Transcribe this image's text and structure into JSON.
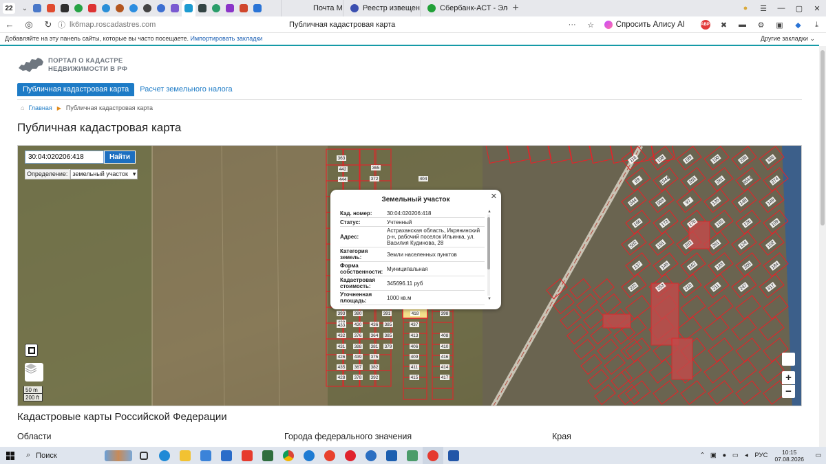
{
  "browser": {
    "tab_count": "22",
    "tabs": [
      {
        "label": "Почта Mail",
        "color": "#1f6fd6"
      },
      {
        "label": "Реестр извещений",
        "color": "#3b4fb0"
      },
      {
        "label": "Сбербанк-АСТ - Электрон",
        "color": "#21a038"
      }
    ],
    "url": "lk6map.roscadastres.com",
    "page_title": "Публичная кадастровая карта",
    "alice_label": "Спросить Алису AI",
    "bookmark_prompt": "Добавляйте на эту панель сайты, которые вы часто посещаете.",
    "bookmark_link": "Импортировать закладки",
    "other_bookmarks": "Другие закладки"
  },
  "site": {
    "logo_line1": "ПОРТАЛ О КАДАСТРЕ",
    "logo_line2": "НЕДВИЖИМОСТИ В РФ",
    "nav": [
      {
        "label": "Публичная кадастровая карта",
        "active": true
      },
      {
        "label": "Расчет земельного налога",
        "active": false
      }
    ],
    "breadcrumbs": {
      "home": "Главная",
      "current": "Публичная кадастровая карта"
    },
    "heading": "Публичная кадастровая карта",
    "section_title": "Кадастровые карты Российской Федерации",
    "columns": [
      "Области",
      "Города федерального значения",
      "Края"
    ]
  },
  "map": {
    "search_value": "30:04:020206:418",
    "search_button": "Найти",
    "definition_label": "Определение:",
    "definition_value": "земельный участок",
    "scale_metric": "50 m",
    "scale_imperial": "200 ft",
    "zoom_in": "+",
    "zoom_out": "−",
    "selected_parcel": "418",
    "parcel_numbers_left": [
      "363",
      "442",
      "444",
      "365",
      "372",
      "438",
      "380",
      "433",
      "432",
      "431",
      "426",
      "435",
      "428",
      "430",
      "376",
      "388",
      "439",
      "367",
      "378",
      "436",
      "364",
      "381",
      "375",
      "382",
      "392",
      "393",
      "391",
      "385",
      "385",
      "379"
    ],
    "parcel_numbers_mid": [
      "404",
      "437",
      "413",
      "406",
      "409",
      "411",
      "415",
      "398",
      "408",
      "410",
      "416",
      "414",
      "417"
    ],
    "parcel_numbers_right": [
      "116",
      "198",
      "199",
      "190",
      "298",
      "386",
      "89",
      "1944",
      "265",
      "281",
      "9644",
      "274",
      "344",
      "968",
      "97",
      "135",
      "148",
      "149",
      "166",
      "173",
      "170",
      "165",
      "126",
      "109",
      "502",
      "191",
      "203",
      "261",
      "124",
      "102",
      "137",
      "146",
      "162",
      "183",
      "205",
      "184",
      "222",
      "253",
      "210",
      "211",
      "247",
      "317"
    ]
  },
  "popup": {
    "title": "Земельный участок",
    "rows": [
      {
        "key": "Кад. номер:",
        "value": "30:04:020206:418"
      },
      {
        "key": "Статус:",
        "value": "Учтенный"
      },
      {
        "key": "Адрес:",
        "value": "Астраханская область, Икрянинский р-н, рабочий поселок Ильинка, ул. Василия Кудинова, 28"
      },
      {
        "key": "Категория земель:",
        "value": "Земли населенных пунктов"
      },
      {
        "key": "Форма собственности:",
        "value": "Муниципальная"
      },
      {
        "key": "Кадастровая стоимость:",
        "value": "345696.11 руб"
      },
      {
        "key": "Уточненная площадь:",
        "value": "1000 кв.м"
      }
    ]
  },
  "taskbar": {
    "search_label": "Поиск",
    "lang": "РУС",
    "time": "10:15",
    "date": "07.08.2026"
  }
}
